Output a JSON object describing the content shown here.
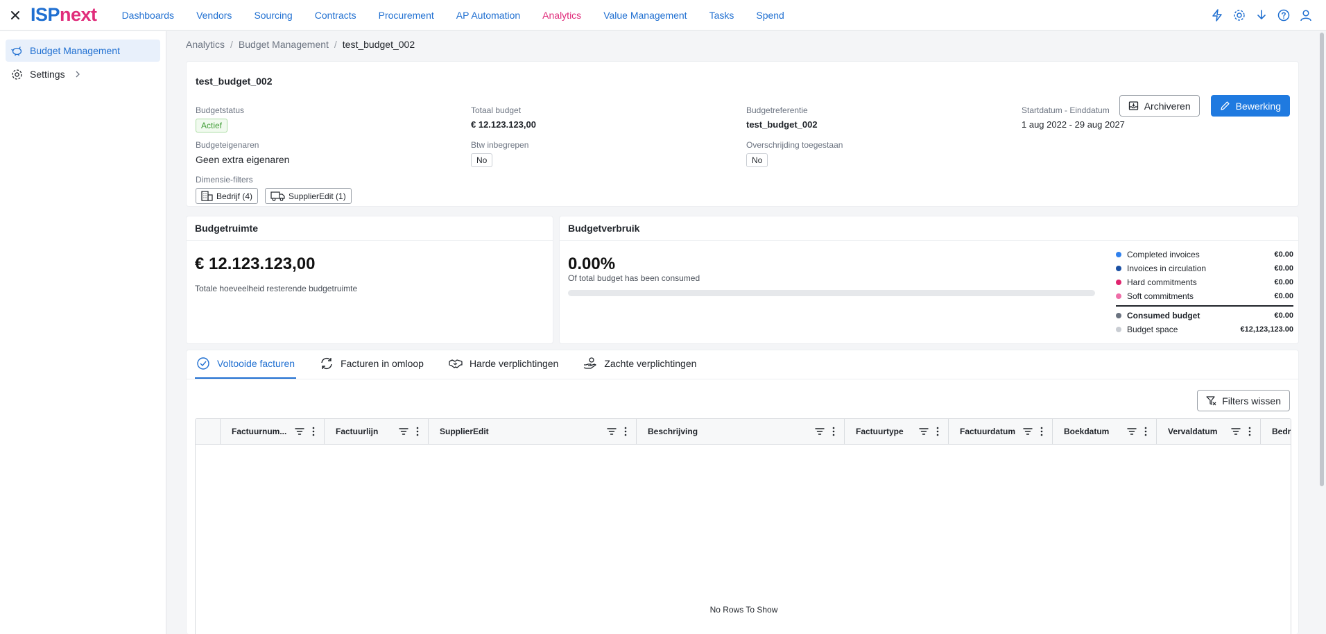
{
  "app": {
    "logo_isp": "ISP",
    "logo_next": "next"
  },
  "nav": {
    "items": [
      "Dashboards",
      "Vendors",
      "Sourcing",
      "Contracts",
      "Procurement",
      "AP Automation",
      "Analytics",
      "Value Management",
      "Tasks",
      "Spend"
    ],
    "active": "Analytics"
  },
  "sidebar": {
    "items": [
      {
        "label": "Budget Management",
        "icon": "piggy-bank-icon"
      },
      {
        "label": "Settings",
        "icon": "gear-icon"
      }
    ]
  },
  "breadcrumb": {
    "items": [
      "Analytics",
      "Budget Management"
    ],
    "current": "test_budget_002"
  },
  "budget": {
    "title": "test_budget_002",
    "archive_label": "Archiveren",
    "edit_label": "Bewerking",
    "status_label": "Budgetstatus",
    "status_value": "Actief",
    "total_label": "Totaal budget",
    "total_value": "€ 12.123.123,00",
    "reference_label": "Budgetreferentie",
    "reference_value": "test_budget_002",
    "period_label": "Startdatum - Einddatum",
    "period_value": "1 aug 2022 - 29 aug 2027",
    "owners_label": "Budgeteigenaren",
    "owners_value": "Geen extra eigenaren",
    "vat_label": "Btw inbegrepen",
    "vat_value": "No",
    "overrun_label": "Overschrijding toegestaan",
    "overrun_value": "No",
    "dimension_label": "Dimensie-filters",
    "dimension_chips": [
      "Bedrijf (4)",
      "SupplierEdit (1)"
    ]
  },
  "space": {
    "title": "Budgetruimte",
    "value": "€ 12.123.123,00",
    "caption": "Totale hoeveelheid resterende budgetruimte"
  },
  "usage": {
    "title": "Budgetverbruik",
    "percent": "0.00%",
    "percent_value": 0,
    "caption": "Of total budget has been consumed",
    "legend": [
      {
        "label": "Completed invoices",
        "value": "€0.00",
        "color": "#2f80ed"
      },
      {
        "label": "Invoices in circulation",
        "value": "€0.00",
        "color": "#1a4fa3"
      },
      {
        "label": "Hard commitments",
        "value": "€0.00",
        "color": "#e0246e"
      },
      {
        "label": "Soft commitments",
        "value": "€0.00",
        "color": "#ee6ea8"
      }
    ],
    "summary": [
      {
        "label": "Consumed budget",
        "value": "€0.00",
        "color": "#6b7380"
      },
      {
        "label": "Budget space",
        "value": "€12,123,123.00",
        "color": "#c9cdd3"
      }
    ]
  },
  "tabs": {
    "items": [
      "Voltooide facturen",
      "Facturen in omloop",
      "Harde verplichtingen",
      "Zachte verplichtingen"
    ],
    "active": "Voltooide facturen"
  },
  "grid": {
    "filters_clear_label": "Filters wissen",
    "columns": [
      "Factuurnum...",
      "Factuurlijn",
      "SupplierEdit",
      "Beschrijving",
      "Factuurtype",
      "Factuurdatum",
      "Boekdatum",
      "Vervaldatum",
      "Bedr"
    ],
    "empty_text": "No Rows To Show"
  },
  "colors": {
    "primary": "#1f7ae0",
    "accent": "#e02d7b",
    "success": "#3f9c35"
  }
}
